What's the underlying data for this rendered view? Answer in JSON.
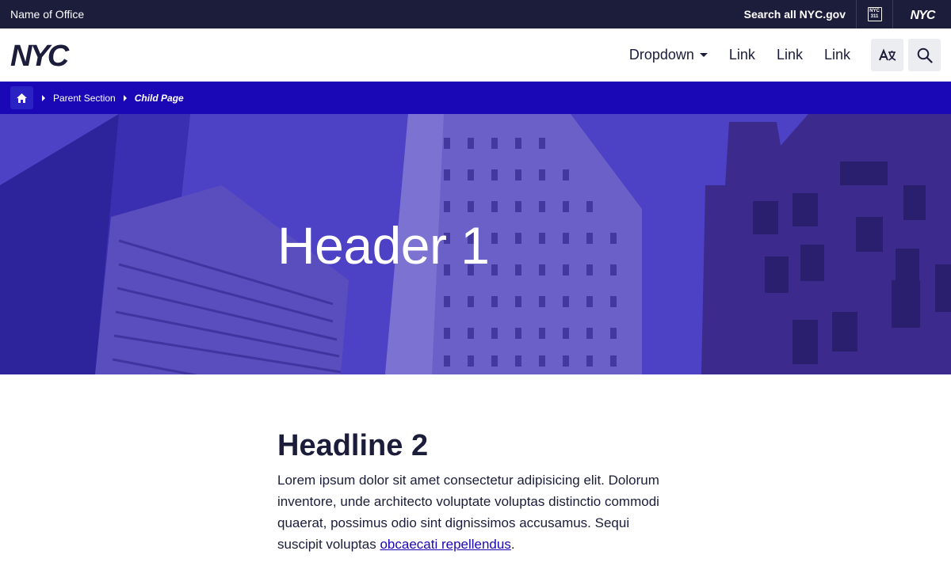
{
  "topbar": {
    "office_name": "Name of Office",
    "search_all": "Search all NYC.gov",
    "nyc311_label_top": "NYC",
    "nyc311_label_bottom": "311",
    "nyc_logo_text": "NYC"
  },
  "header": {
    "logo_text": "NYC",
    "nav": {
      "dropdown_label": "Dropdown",
      "links": [
        "Link",
        "Link",
        "Link"
      ]
    }
  },
  "breadcrumb": {
    "parent": "Parent Section",
    "current": "Child Page"
  },
  "hero": {
    "title": "Header 1"
  },
  "content": {
    "headline": "Headline 2",
    "paragraph_text": "Lorem ipsum dolor sit amet consectetur adipisicing elit. Dolorum inventore, unde architecto voluptate voluptas distinctio commodi quaerat, possimus odio sint dignissimos accusamus. Sequi suscipit voluptas ",
    "paragraph_link": "obcaecati repellendus",
    "paragraph_end": "."
  },
  "colors": {
    "dark_navy": "#1b1d3a",
    "brand_blue": "#1a07b5",
    "hero_overlay": "#4c3fc8",
    "icon_button_bg": "#ebedf1"
  },
  "icons": [
    "nyc311-icon",
    "translate-icon",
    "search-icon",
    "home-icon",
    "chevron-right-icon",
    "caret-down-icon"
  ]
}
